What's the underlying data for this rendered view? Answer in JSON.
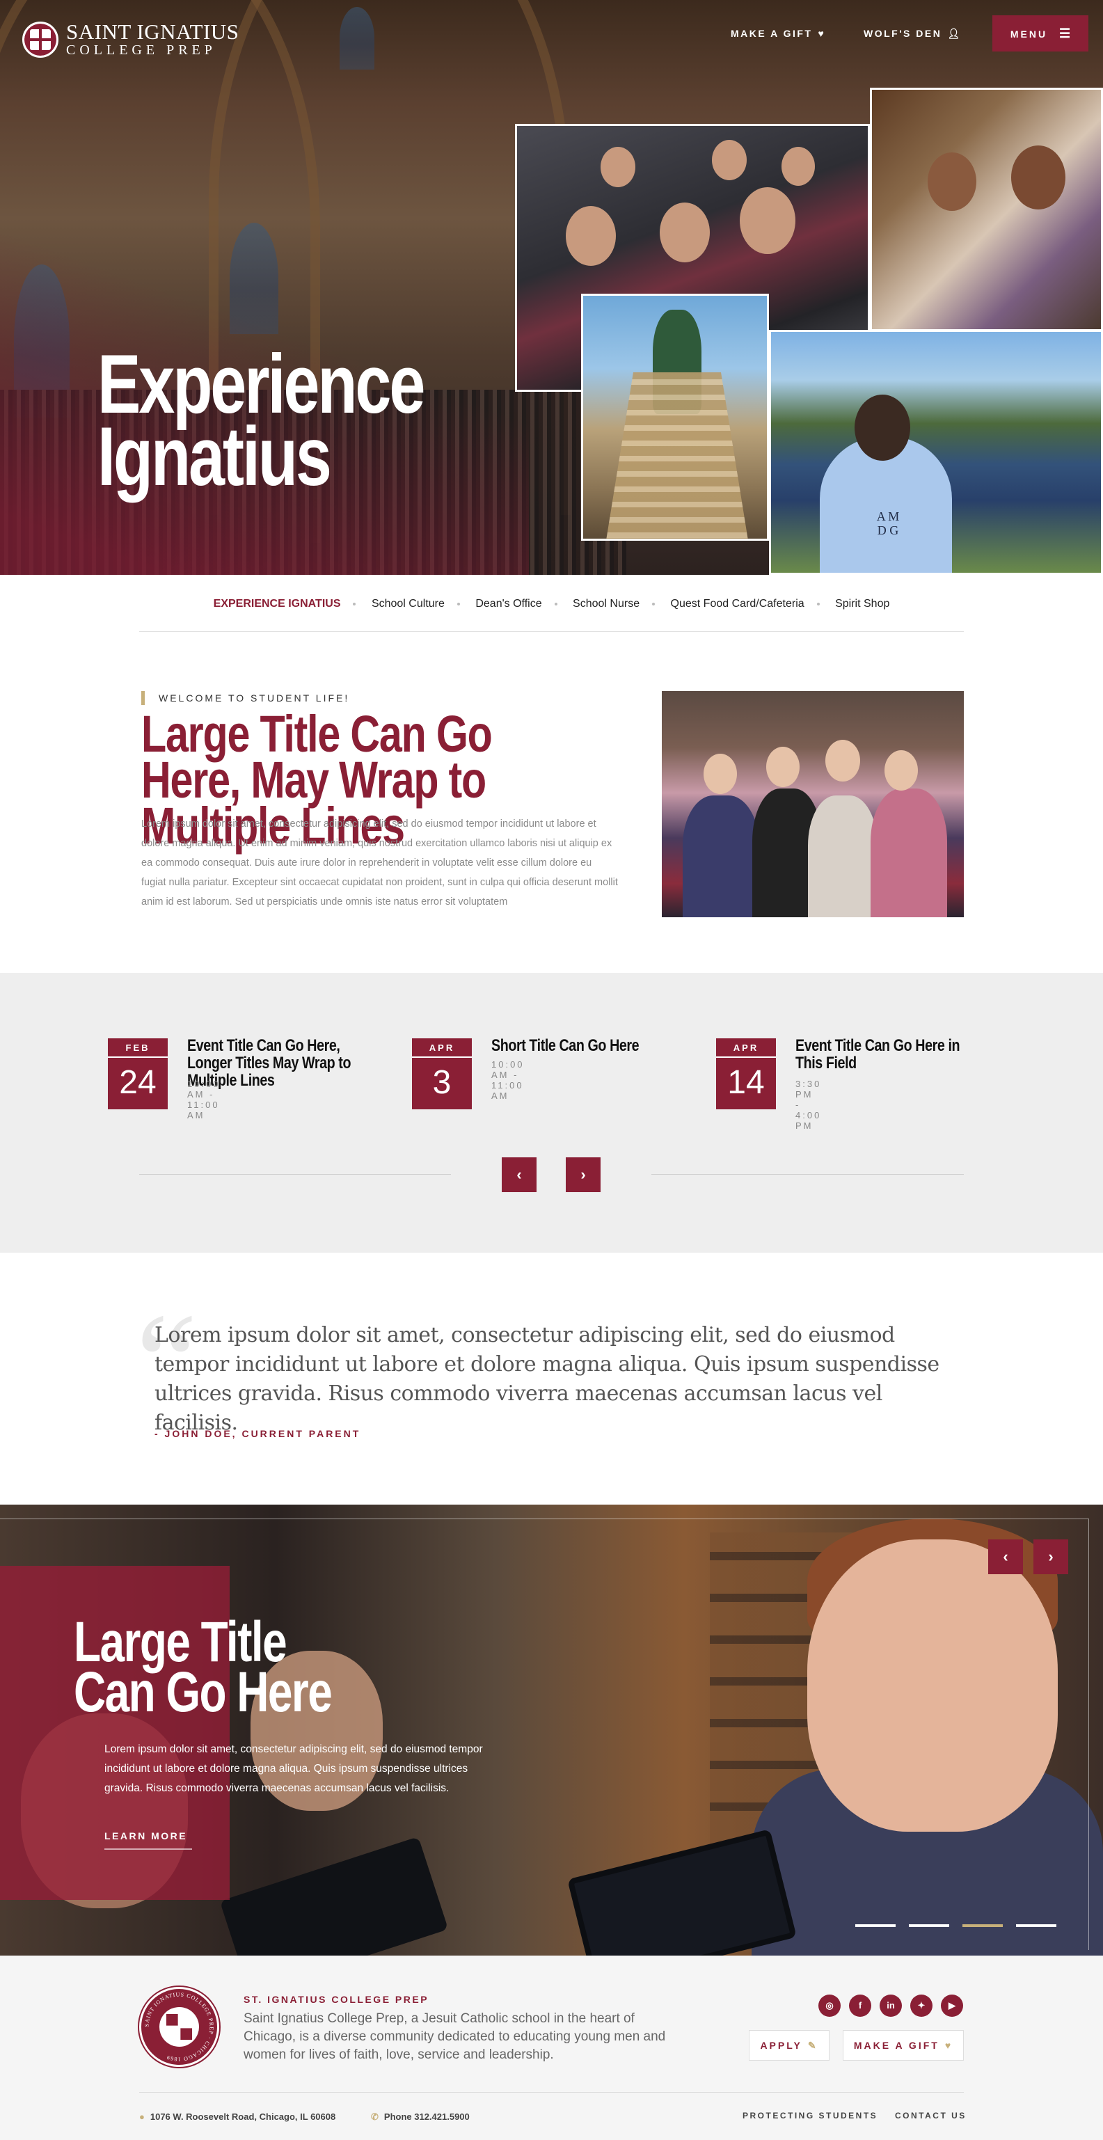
{
  "header": {
    "logo_line1": "SAINT IGNATIUS",
    "logo_line2": "COLLEGE PREP",
    "make_gift": "MAKE A GIFT",
    "wolfs_den": "WOLF'S DEN",
    "menu": "MENU",
    "icons": [
      "heart-icon",
      "user-icon",
      "hamburger-icon"
    ]
  },
  "hero": {
    "title_line1": "Experience",
    "title_line2": "Ignatius",
    "shirt_logo": "A M\nD G"
  },
  "subnav": {
    "items": [
      {
        "label": "EXPERIENCE IGNATIUS",
        "active": true
      },
      {
        "label": "School Culture"
      },
      {
        "label": "Dean's Office"
      },
      {
        "label": "School Nurse"
      },
      {
        "label": "Quest Food Card/Cafeteria"
      },
      {
        "label": "Spirit Shop"
      }
    ]
  },
  "welcome": {
    "eyebrow": "WELCOME TO STUDENT LIFE!",
    "title": "Large Title Can Go Here, May Wrap to Multiple Lines",
    "body": "Lorem ipsum dolor sit amet, consectetur adipisicing elit, sed do eiusmod tempor incididunt ut labore et dolore magna aliqua. Ut enim ad minim veniam, quis nostrud exercitation ullamco laboris nisi ut aliquip ex ea commodo consequat. Duis aute irure dolor in reprehenderit in voluptate velit esse cillum dolore eu fugiat nulla pariatur. Excepteur sint occaecat cupidatat non proident, sunt in culpa qui officia deserunt mollit anim id est laborum. Sed ut perspiciatis unde omnis iste natus error sit voluptatem"
  },
  "events": [
    {
      "month": "FEB",
      "day": "24",
      "title": "Event Title Can Go Here, Longer Titles May Wrap to Multiple Lines",
      "time": "10:00 AM - 11:00 AM"
    },
    {
      "month": "APR",
      "day": "3",
      "title": "Short Title Can Go Here",
      "time": "10:00 AM - 11:00 AM"
    },
    {
      "month": "APR",
      "day": "14",
      "title": "Event Title Can Go Here in This Field",
      "time": "3:30 PM - 4:00 PM"
    }
  ],
  "quote": {
    "text": "Lorem ipsum dolor sit amet, consectetur adipiscing elit, sed do eiusmod tempor incididunt ut labore et dolore magna aliqua. Quis ipsum suspendisse ultrices gravida. Risus commodo viverra maecenas accumsan lacus vel facilisis.",
    "author": "- JOHN DOE, CURRENT PARENT"
  },
  "feature": {
    "title_line1": "Large Title",
    "title_line2": "Can Go Here",
    "body": "Lorem ipsum dolor sit amet, consectetur adipiscing elit, sed do eiusmod tempor incididunt ut labore et dolore magna aliqua. Quis ipsum suspendisse ultrices gravida. Risus commodo viverra maecenas accumsan lacus vel facilisis.",
    "cta": "LEARN MORE",
    "active_slide": 3,
    "slide_count": 4
  },
  "footer": {
    "org": "ST. IGNATIUS COLLEGE PREP",
    "description": "Saint Ignatius College Prep, a Jesuit Catholic school in the heart of Chicago, is a diverse community dedicated to educating young men and women for lives of faith, love, service and leadership.",
    "social": [
      {
        "name": "instagram-icon",
        "glyph": "◎"
      },
      {
        "name": "facebook-icon",
        "glyph": "f"
      },
      {
        "name": "linkedin-icon",
        "glyph": "in"
      },
      {
        "name": "twitter-icon",
        "glyph": "✦"
      },
      {
        "name": "youtube-icon",
        "glyph": "▶"
      }
    ],
    "apply": "APPLY",
    "make_gift": "MAKE A GIFT",
    "address": "1076 W. Roosevelt Road, Chicago, IL 60608",
    "phone": "Phone 312.421.5900",
    "protecting": "PROTECTING STUDENTS",
    "contact": "CONTACT US",
    "seal_text": "SAINT IGNATIUS COLLEGE PREP · CHICAGO 1869",
    "colors": {
      "brand": "#8a1f35",
      "accent": "#c7b07a"
    }
  }
}
